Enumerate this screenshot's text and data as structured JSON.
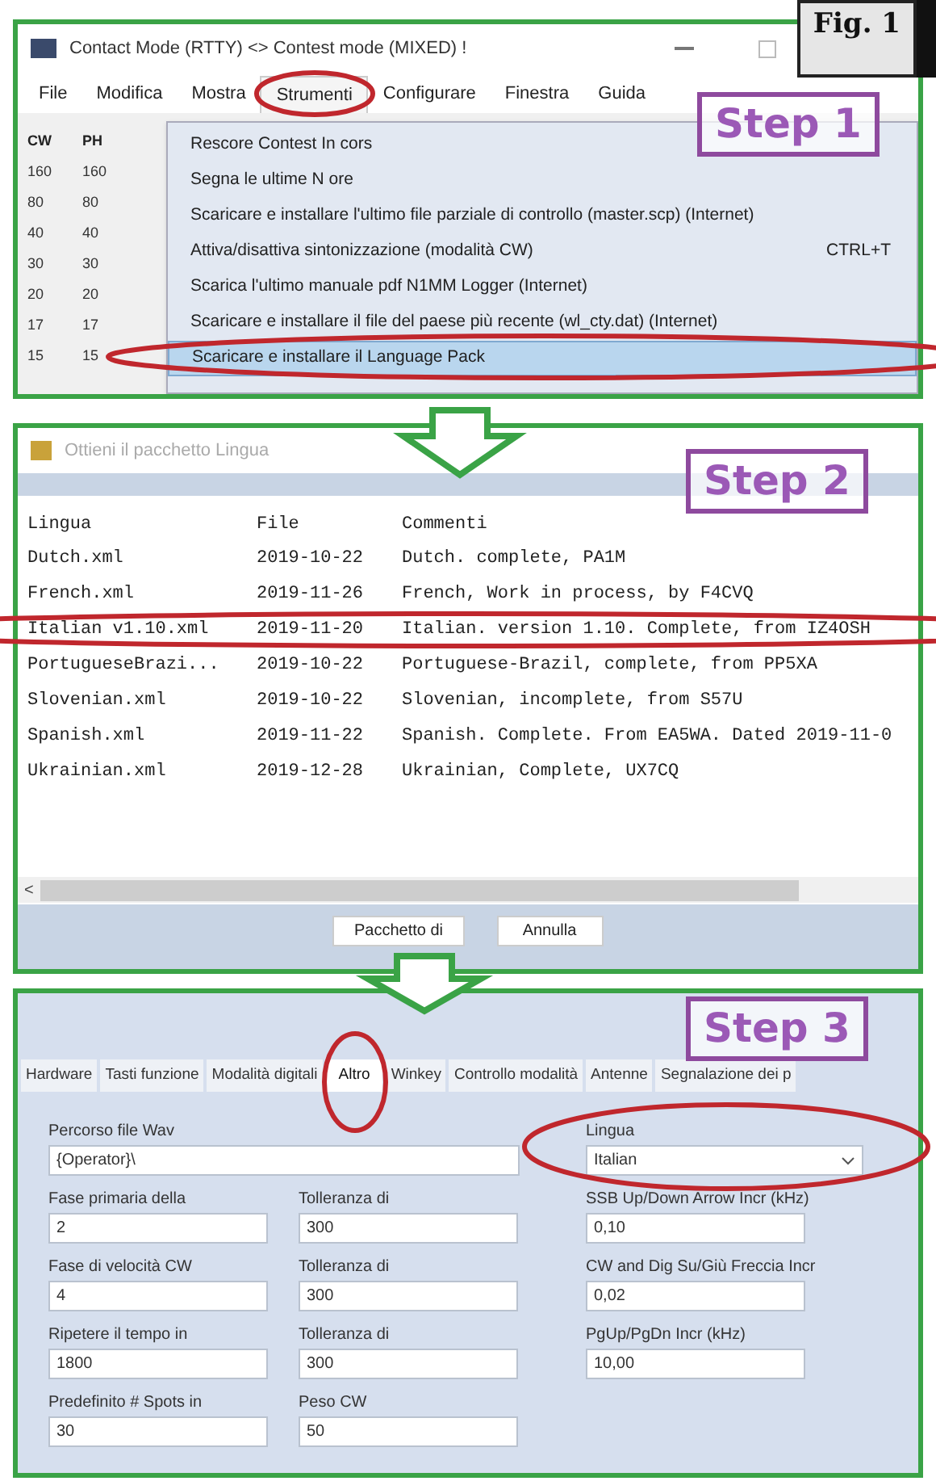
{
  "figure_label": "Fig. 1",
  "step1": {
    "step": "Step 1",
    "window_title": "Contact Mode (RTTY) <> Contest mode (MIXED) !",
    "menu": [
      {
        "label": "File",
        "selected": false
      },
      {
        "label": "Modifica",
        "selected": false
      },
      {
        "label": "Mostra",
        "selected": false
      },
      {
        "label": "Strumenti",
        "selected": true
      },
      {
        "label": "Configurare",
        "selected": false
      },
      {
        "label": "Finestra",
        "selected": false
      },
      {
        "label": "Guida",
        "selected": false
      }
    ],
    "band_columns": [
      "CW",
      "PH"
    ],
    "bands": [
      [
        "160",
        "160"
      ],
      [
        "80",
        "80"
      ],
      [
        "40",
        "40"
      ],
      [
        "30",
        "30"
      ],
      [
        "20",
        "20"
      ],
      [
        "17",
        "17"
      ],
      [
        "15",
        "15"
      ]
    ],
    "dropdown": [
      {
        "label": "Rescore Contest In cors",
        "selected": false
      },
      {
        "label": "Segna le ultime N ore",
        "selected": false
      },
      {
        "label": "Scaricare e installare l'ultimo file parziale di controllo (master.scp) (Internet)",
        "selected": false
      },
      {
        "label": "Attiva/disattiva sintonizzazione (modalità CW)",
        "shortcut": "CTRL+T",
        "selected": false
      },
      {
        "label": "Scarica l'ultimo manuale pdf N1MM Logger (Internet)",
        "selected": false
      },
      {
        "label": "Scaricare e installare il file del paese più recente (wl_cty.dat) (Internet)",
        "selected": false
      },
      {
        "label": "Scaricare e installare il Language Pack",
        "selected": true
      }
    ]
  },
  "step2": {
    "step": "Step 2",
    "window_title": "Ottieni il pacchetto Lingua",
    "columns": [
      "Lingua",
      "File",
      "Commenti"
    ],
    "rows": [
      [
        "Dutch.xml",
        "2019-10-22",
        "Dutch. complete, PA1M"
      ],
      [
        "French.xml",
        "2019-11-26",
        "French, Work in process, by F4CVQ"
      ],
      [
        "Italian v1.10.xml",
        "2019-11-20",
        "Italian. version 1.10. Complete, from IZ4OSH"
      ],
      [
        "PortugueseBrazi...",
        "2019-10-22",
        "Portuguese-Brazil, complete, from PP5XA"
      ],
      [
        "Slovenian.xml",
        "2019-10-22",
        "Slovenian, incomplete, from S57U"
      ],
      [
        "Spanish.xml",
        "2019-11-22",
        "Spanish. Complete. From EA5WA. Dated 2019-11-0"
      ],
      [
        "Ukrainian.xml",
        "2019-12-28",
        "Ukrainian, Complete, UX7CQ"
      ]
    ],
    "scroll_left": "<",
    "buttons": [
      "Pacchetto di",
      "Annulla"
    ]
  },
  "step3": {
    "step": "Step 3",
    "tabs": [
      {
        "label": "Hardware",
        "selected": false
      },
      {
        "label": "Tasti funzione",
        "selected": false
      },
      {
        "label": "Modalità digitali",
        "selected": false
      },
      {
        "label": "Altro",
        "selected": true
      },
      {
        "label": "Winkey",
        "selected": false
      },
      {
        "label": "Controllo modalità",
        "selected": false
      },
      {
        "label": "Antenne",
        "selected": false
      },
      {
        "label": "Segnalazione dei p",
        "selected": false
      }
    ],
    "field_rows": [
      [
        {
          "kind": "wide",
          "label": "Percorso file Wav",
          "value": "{Operator}\\"
        },
        {
          "kind": "select",
          "label": "Lingua",
          "value": "Italian"
        }
      ],
      [
        {
          "kind": "text",
          "label": "Fase primaria della",
          "value": "2"
        },
        {
          "kind": "text",
          "label": "Tolleranza di",
          "value": "300"
        },
        {
          "kind": "text",
          "label": "SSB Up/Down Arrow Incr (kHz)",
          "value": "0,10"
        }
      ],
      [
        {
          "kind": "text",
          "label": "Fase di velocità CW",
          "value": "4"
        },
        {
          "kind": "text",
          "label": "Tolleranza di",
          "value": "300"
        },
        {
          "kind": "text",
          "label": "CW and Dig Su/Giù Freccia Incr",
          "value": "0,02"
        }
      ],
      [
        {
          "kind": "text",
          "label": "Ripetere il tempo in",
          "value": "1800"
        },
        {
          "kind": "text",
          "label": "Tolleranza di",
          "value": "300"
        },
        {
          "kind": "text",
          "label": "PgUp/PgDn Incr (kHz)",
          "value": "10,00"
        }
      ],
      [
        {
          "kind": "text",
          "label": "Predefinito # Spots in",
          "value": "30"
        },
        {
          "kind": "text",
          "label": "Peso CW",
          "value": "50"
        }
      ]
    ]
  }
}
